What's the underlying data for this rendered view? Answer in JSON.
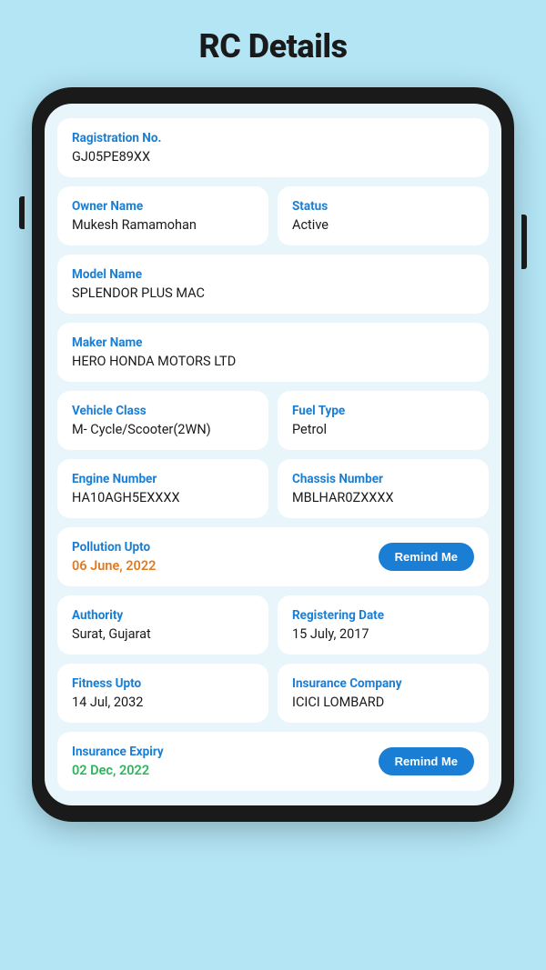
{
  "page": {
    "title": "RC Details"
  },
  "fields": {
    "registration_label": "Ragistration No.",
    "registration_value": "GJ05PE89XX",
    "owner_label": "Owner Name",
    "owner_value": "Mukesh Ramamohan",
    "status_label": "Status",
    "status_value": "Active",
    "model_label": "Model Name",
    "model_value": "SPLENDOR PLUS MAC",
    "maker_label": "Maker Name",
    "maker_value": "HERO HONDA MOTORS LTD",
    "vehicle_class_label": "Vehicle Class",
    "vehicle_class_value": "M- Cycle/Scooter(2WN)",
    "fuel_type_label": "Fuel Type",
    "fuel_type_value": "Petrol",
    "engine_number_label": "Engine Number",
    "engine_number_value": "HA10AGH5EXXXX",
    "chassis_number_label": "Chassis Number",
    "chassis_number_value": "MBLHAR0ZXXXX",
    "pollution_upto_label": "Pollution Upto",
    "pollution_upto_value": "06 June, 2022",
    "remind_me_1": "Remind Me",
    "authority_label": "Authority",
    "authority_value": "Surat, Gujarat",
    "registering_date_label": "Registering Date",
    "registering_date_value": "15 July, 2017",
    "fitness_upto_label": "Fitness Upto",
    "fitness_upto_value": "14 Jul, 2032",
    "insurance_company_label": "Insurance Company",
    "insurance_company_value": "ICICI LOMBARD",
    "insurance_expiry_label": "Insurance Expiry",
    "insurance_expiry_value": "02 Dec, 2022",
    "remind_me_2": "Remind Me"
  }
}
